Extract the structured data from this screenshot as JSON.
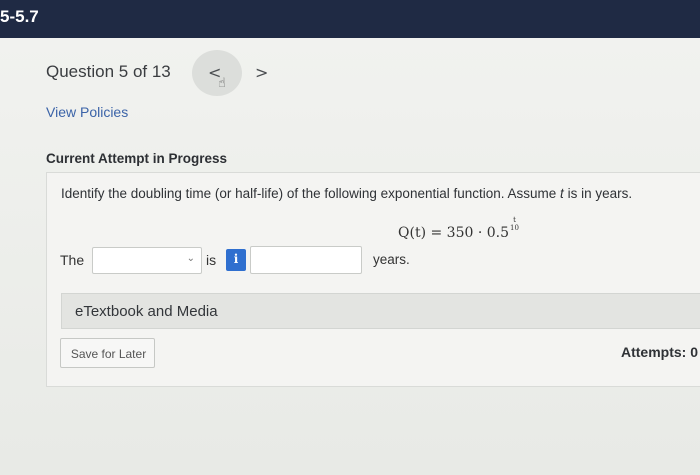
{
  "header": {
    "section_label": "5-5.7"
  },
  "question_nav": {
    "title": "Question 5 of 13",
    "prev_icon": "chevron-left-icon",
    "next_icon": "chevron-right-icon",
    "prev_glyph": "<",
    "next_glyph": ">"
  },
  "policies_link": "View Policies",
  "attempt_heading": "Current Attempt in Progress",
  "question": {
    "prompt_before": "Identify the doubling time (or half-life) of the following exponential function. Assume ",
    "prompt_var": "t",
    "prompt_after": " is in years.",
    "formula_lhs": "Q(t)",
    "formula_eq": " = ",
    "formula_rhs": "350 · 0.5",
    "exponent_num": "t",
    "exponent_den": "10"
  },
  "answer_row": {
    "the_label": "The",
    "select_value": "",
    "is_label": "is",
    "info_glyph": "i",
    "input_value": "",
    "units_label": "years."
  },
  "etextbook_label": "eTextbook and Media",
  "save_label": "Save for Later",
  "attempts_label": "Attempts: 0",
  "colors": {
    "header_bg": "#1f2a44",
    "link": "#3b63a8",
    "info_button": "#2f6fcf"
  }
}
